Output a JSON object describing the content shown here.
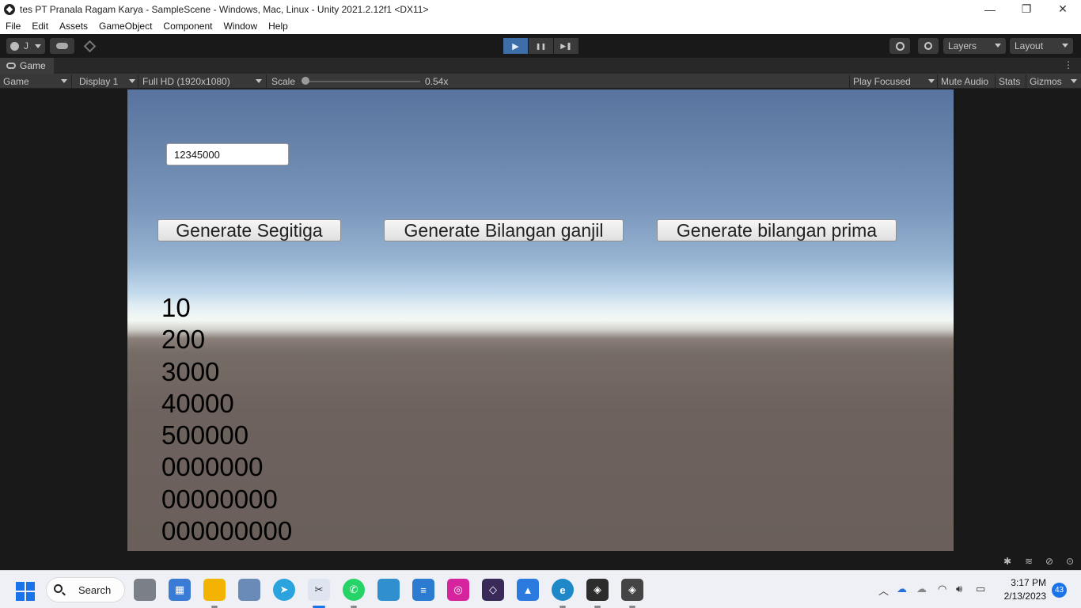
{
  "window": {
    "title": "tes PT Pranala Ragam Karya - SampleScene - Windows, Mac, Linux - Unity 2021.2.12f1 <DX11>",
    "minimize_glyph": "—",
    "restore_glyph": "❐",
    "close_glyph": "✕"
  },
  "menu": {
    "items": [
      "File",
      "Edit",
      "Assets",
      "GameObject",
      "Component",
      "Window",
      "Help"
    ]
  },
  "toolbar": {
    "account_label": "J",
    "layers_label": "Layers",
    "layout_label": "Layout",
    "play_glyph": "▶",
    "pause_glyph": "❚❚",
    "step_glyph": "▶❚"
  },
  "game_tab": {
    "label": "Game"
  },
  "game_controls": {
    "view_mode": "Game",
    "display": "Display 1",
    "resolution": "Full HD (1920x1080)",
    "scale_label": "Scale",
    "scale_value": "0.54x",
    "scale_level": 0.0,
    "play_focused": "Play Focused",
    "mute_audio": "Mute Audio",
    "stats": "Stats",
    "gizmos": "Gizmos"
  },
  "game": {
    "input_value": "12345000",
    "buttons": [
      "Generate Segitiga",
      "Generate Bilangan ganjil",
      "Generate bilangan prima"
    ],
    "output_lines": [
      "10",
      "200",
      "3000",
      "40000",
      "500000",
      "0000000",
      "00000000",
      "000000000"
    ]
  },
  "taskbar": {
    "search_label": "Search",
    "time": "3:17 PM",
    "date": "2/13/2023",
    "notification_count": "43"
  },
  "colors": {
    "accent": "#3e6ea8",
    "editor_bg": "#191919",
    "windows_blue": "#1a73e8"
  }
}
